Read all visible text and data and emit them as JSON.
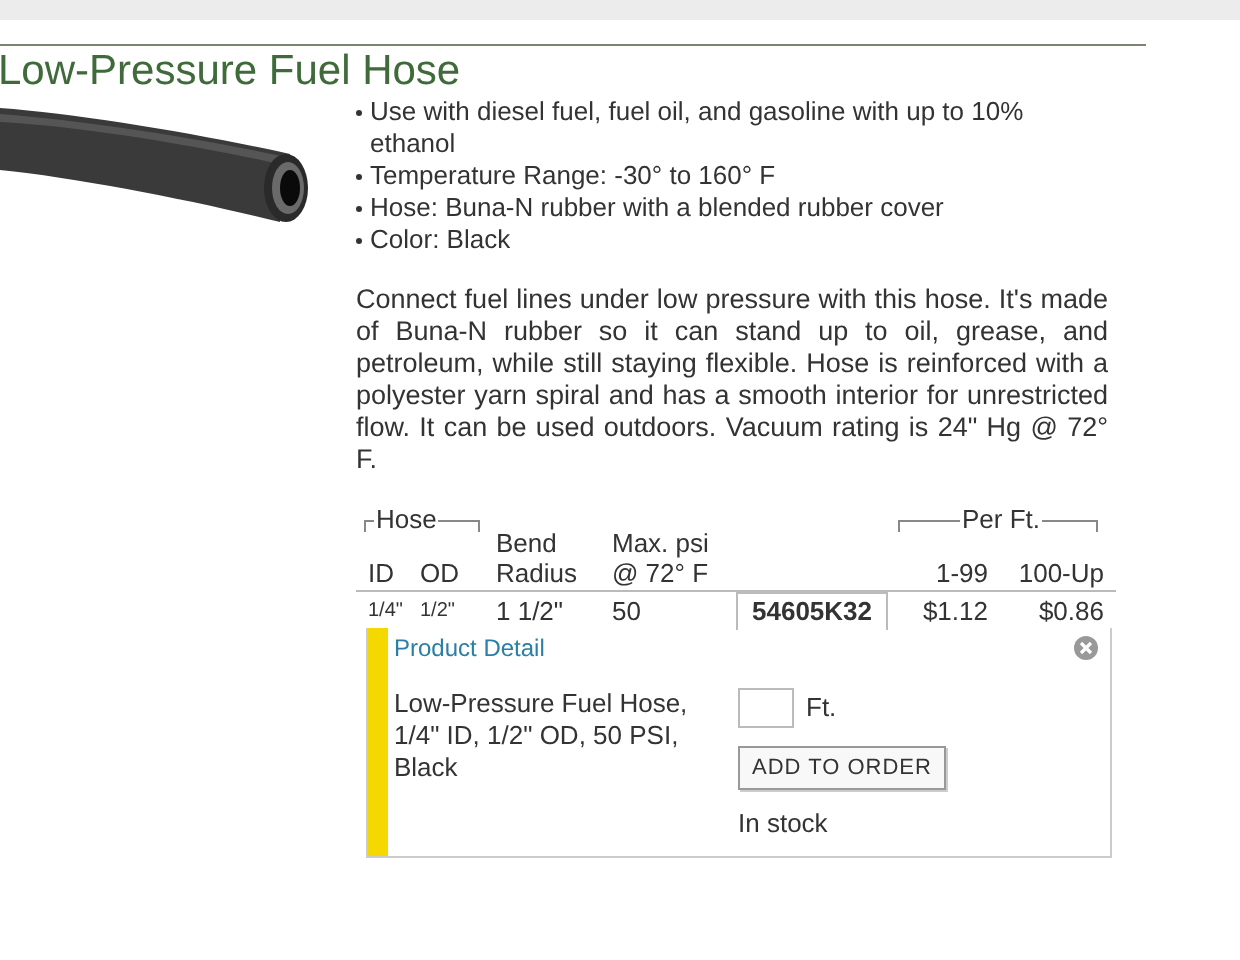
{
  "title": "Low-Pressure Fuel Hose",
  "bullets": [
    "Use with diesel fuel, fuel oil, and gasoline with up to 10% ethanol",
    "Temperature Range: -30° to 160° F",
    "Hose: Buna-N rubber with a blended rubber cover",
    "Color: Black"
  ],
  "description": "Connect fuel lines under low pressure with this hose. It's made of Buna-N rubber so it can stand up to oil, grease, and petroleum, while still staying flexible. Hose is reinforced with a polyester yarn spiral and has a smooth interior for unrestricted flow. It can be used outdoors. Vacuum rating is 24\" Hg @ 72° F.",
  "table": {
    "group_headers": [
      "Hose",
      "Per Ft."
    ],
    "columns": [
      [
        "ID"
      ],
      [
        "OD"
      ],
      [
        "Bend",
        "Radius"
      ],
      [
        "Max. psi",
        "@ 72° F"
      ],
      [],
      [
        "1-99"
      ],
      [
        "100-Up"
      ]
    ],
    "rows": [
      {
        "id": "1/4\"",
        "od": "1/2\"",
        "bend_radius": "1 1/2\"",
        "max_psi": "50",
        "part_number": "54605K32",
        "price_1_99": "$1.12",
        "price_100_up": "$0.86",
        "selected": true
      }
    ]
  },
  "detail": {
    "heading": "Product Detail",
    "description": "Low-Pressure Fuel Hose, 1/4\" ID, 1/2\" OD, 50 PSI, Black",
    "unit": "Ft.",
    "button": "ADD TO ORDER",
    "stock": "In stock"
  }
}
